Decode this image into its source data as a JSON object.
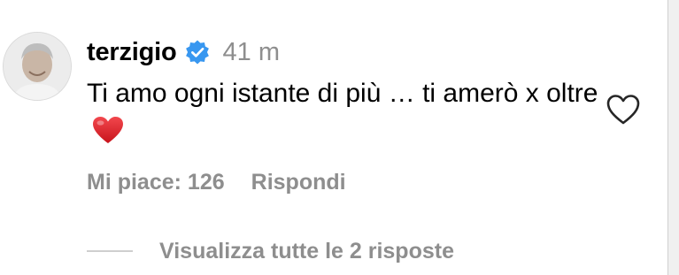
{
  "comment": {
    "username": "terzigio",
    "verified": true,
    "time": "41 m",
    "text": "Ti amo ogni istante di più … ti amerò x oltre",
    "emoji": "red-heart-emoji",
    "likes_label": "Mi piace: 126",
    "reply_label": "Rispondi",
    "view_replies_label": "Visualizza tutte le 2 risposte"
  },
  "icons": {
    "verified": "verified-badge-icon",
    "like": "heart-outline-icon",
    "avatar": "profile-photo"
  },
  "colors": {
    "verified_blue": "#3897f0",
    "secondary_text": "#8e8e8e",
    "heart_red": "#e0242b"
  }
}
